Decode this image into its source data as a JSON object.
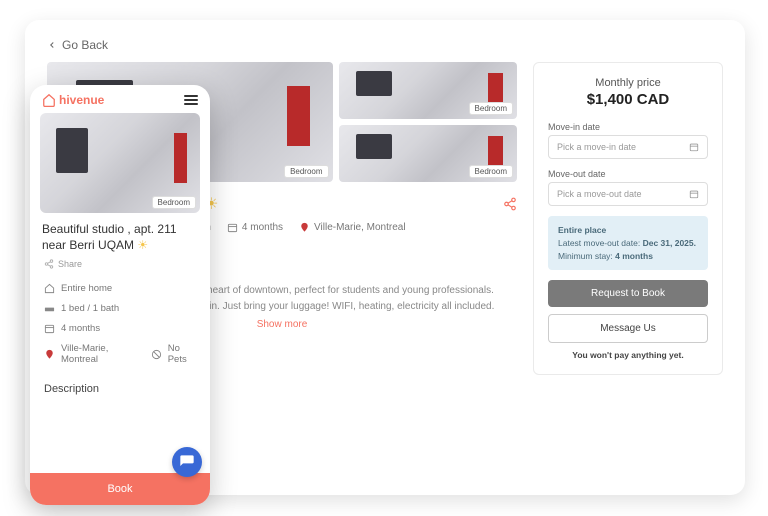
{
  "go_back": "Go Back",
  "listing": {
    "title_short": "211 near Berri UQAM",
    "title_full": "Beautiful studio , apt. 211 near Berri UQAM",
    "badge": "Bedroom",
    "meta": {
      "bath": "ath",
      "duration": "4 months",
      "location": "Ville-Marie, Montreal"
    },
    "desc_line1": "n the heart of downtown, perfect for students and young professionals.",
    "desc_line2": "move in. Just bring your luggage! WIFI, heating, electricity all included.",
    "show_more": "Show more"
  },
  "pricing": {
    "label": "Monthly price",
    "value": "$1,400 CAD",
    "movein_label": "Move-in date",
    "movein_placeholder": "Pick a move-in date",
    "moveout_label": "Move-out date",
    "moveout_placeholder": "Pick a move-out date",
    "info_title": "Entire place",
    "info_moveout": "Latest move-out date: ",
    "info_moveout_date": "Dec 31, 2025.",
    "info_min": "Minimum stay: ",
    "info_min_val": "4 months",
    "request": "Request to Book",
    "message": "Message Us",
    "pay_note": "You won't pay anything yet."
  },
  "mobile": {
    "brand": "hivenue",
    "share": "Share",
    "home": "Entire home",
    "beds": "1 bed / 1 bath",
    "duration": "4 months",
    "location": "Ville-Marie, Montreal",
    "pets": "No Pets",
    "desc_h": "Description",
    "book": "Book"
  }
}
